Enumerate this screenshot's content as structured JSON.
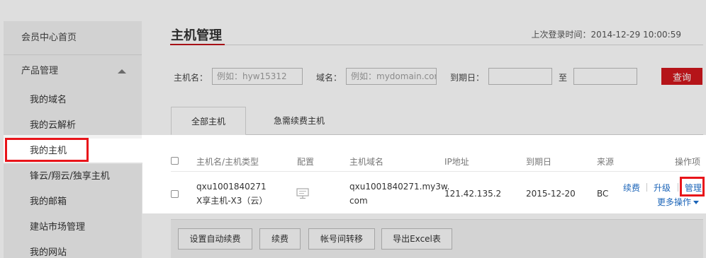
{
  "sidebar": {
    "home": "会员中心首页",
    "group": "产品管理",
    "items": [
      {
        "label": "我的域名"
      },
      {
        "label": "我的云解析"
      },
      {
        "label": "我的主机"
      },
      {
        "label": "锋云/翔云/独享主机"
      },
      {
        "label": "我的邮箱"
      },
      {
        "label": "建站市场管理"
      },
      {
        "label": "我的网站"
      }
    ]
  },
  "header": {
    "title": "主机管理",
    "last_login": "上次登录时间：2014-12-29 10:00:59"
  },
  "filter": {
    "host_label": "主机名：",
    "host_placeholder": "例如：hyw15312",
    "domain_label": "域名：",
    "domain_placeholder": "例如：mydomain.com",
    "expiry_label": "到期日：",
    "to_label": "至",
    "query_button": "查询"
  },
  "tabs": [
    {
      "label": "全部主机"
    },
    {
      "label": "急需续费主机"
    }
  ],
  "table": {
    "columns": [
      "主机名/主机类型",
      "配置",
      "主机域名",
      "IP地址",
      "到期日",
      "来源",
      "操作项"
    ],
    "rows": [
      {
        "host_name": "qxu1001840271",
        "host_type": "X享主机-X3（云）",
        "domain_line1": "qxu1001840271.my3w.",
        "domain_line2": "com",
        "ip": "121.42.135.2",
        "expiry": "2015-12-20",
        "source": "BC",
        "actions": {
          "renew": "续费",
          "upgrade": "升级",
          "manage": "管理",
          "more": "更多操作"
        }
      }
    ]
  },
  "bulk_actions": [
    "设置自动续费",
    "续费",
    "帐号间转移",
    "导出Excel表"
  ],
  "colors": {
    "accent_red": "#d0171d",
    "link_blue": "#1b64b8",
    "highlight_red": "#e8141a"
  }
}
